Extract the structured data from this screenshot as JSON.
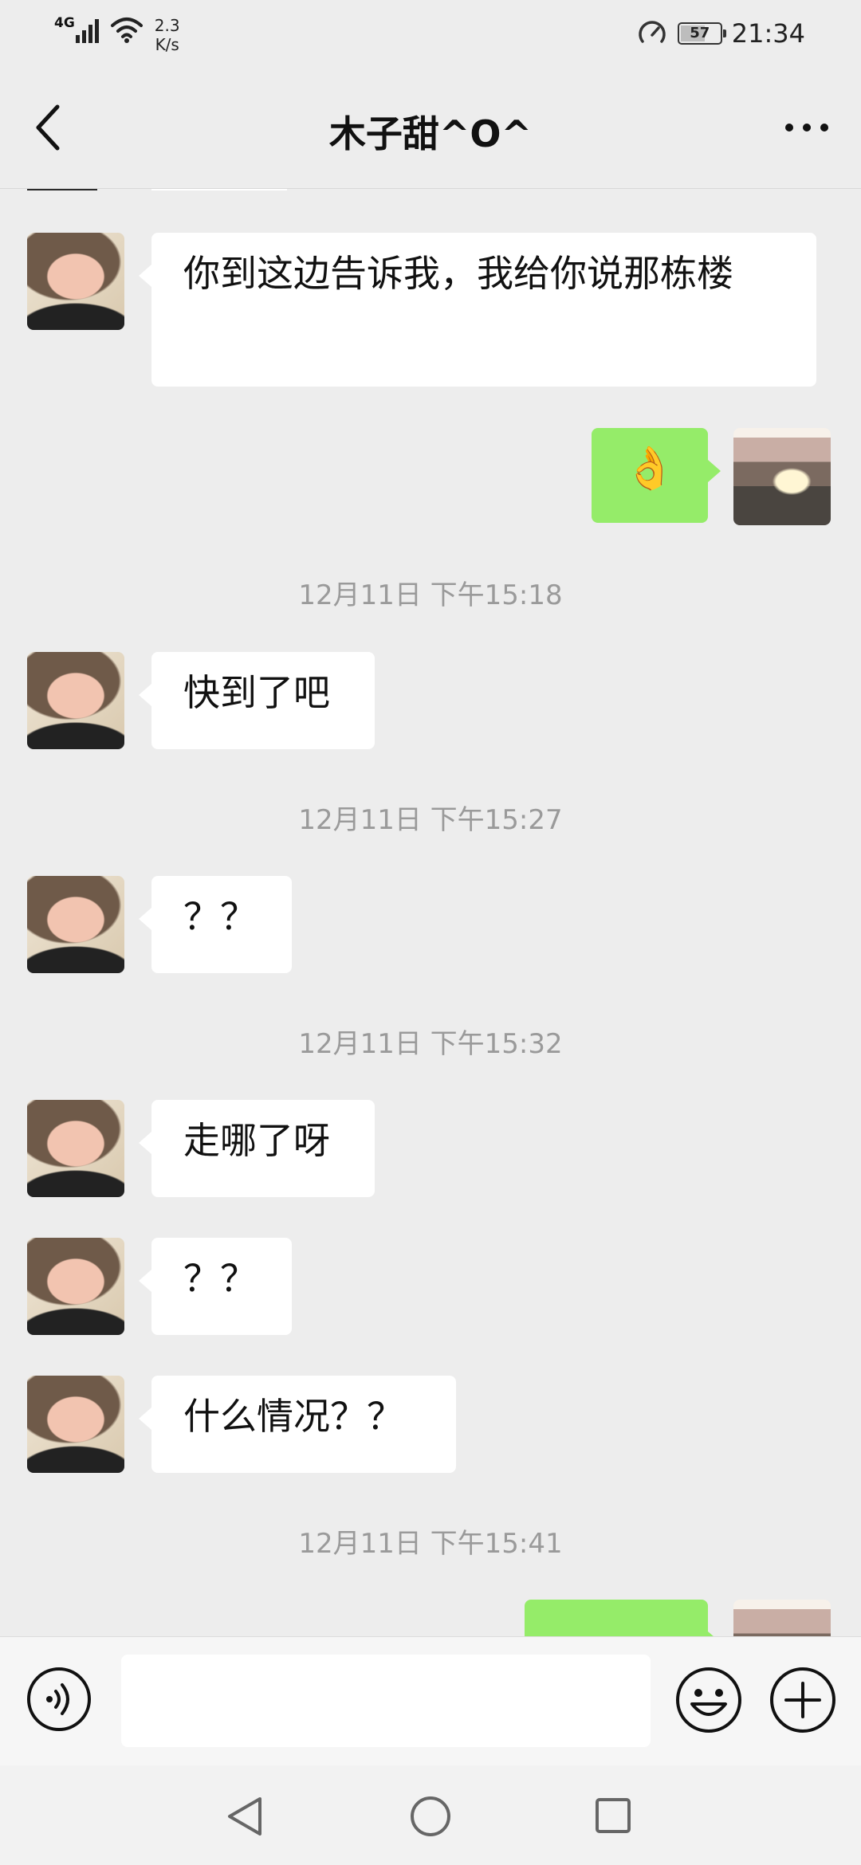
{
  "status_bar": {
    "network_type": "4G",
    "speed_value": "2.3",
    "speed_unit": "K/s",
    "battery_level": "57",
    "time": "21:34"
  },
  "header": {
    "title": "木子甜^O^",
    "back_icon": "chevron-left-icon",
    "more_icon": "more-dots-icon"
  },
  "messages": [
    {
      "side": "left",
      "text": "你到这边告诉我，我给你说那栋楼"
    },
    {
      "side": "right",
      "text": "👌"
    },
    {
      "time": "12月11日 下午15:18"
    },
    {
      "side": "left",
      "text": "快到了吧"
    },
    {
      "time": "12月11日 下午15:27"
    },
    {
      "side": "left",
      "text": "？？"
    },
    {
      "time": "12月11日 下午15:32"
    },
    {
      "side": "left",
      "text": "走哪了呀"
    },
    {
      "side": "left",
      "text": "？？"
    },
    {
      "side": "left",
      "text": "什么情况？？"
    },
    {
      "time": "12月11日 下午15:41"
    }
  ],
  "input_bar": {
    "voice_icon": "voice-icon",
    "text_value": "",
    "emoji_icon": "emoji-icon",
    "plus_icon": "plus-icon"
  },
  "nav_bar": {
    "back_icon": "nav-back-icon",
    "home_icon": "nav-home-icon",
    "recent_icon": "nav-recent-icon"
  },
  "colors": {
    "background": "#ededed",
    "bubble_self": "#95ec69",
    "bubble_other": "#ffffff",
    "timestamp": "#9a9a9a"
  }
}
